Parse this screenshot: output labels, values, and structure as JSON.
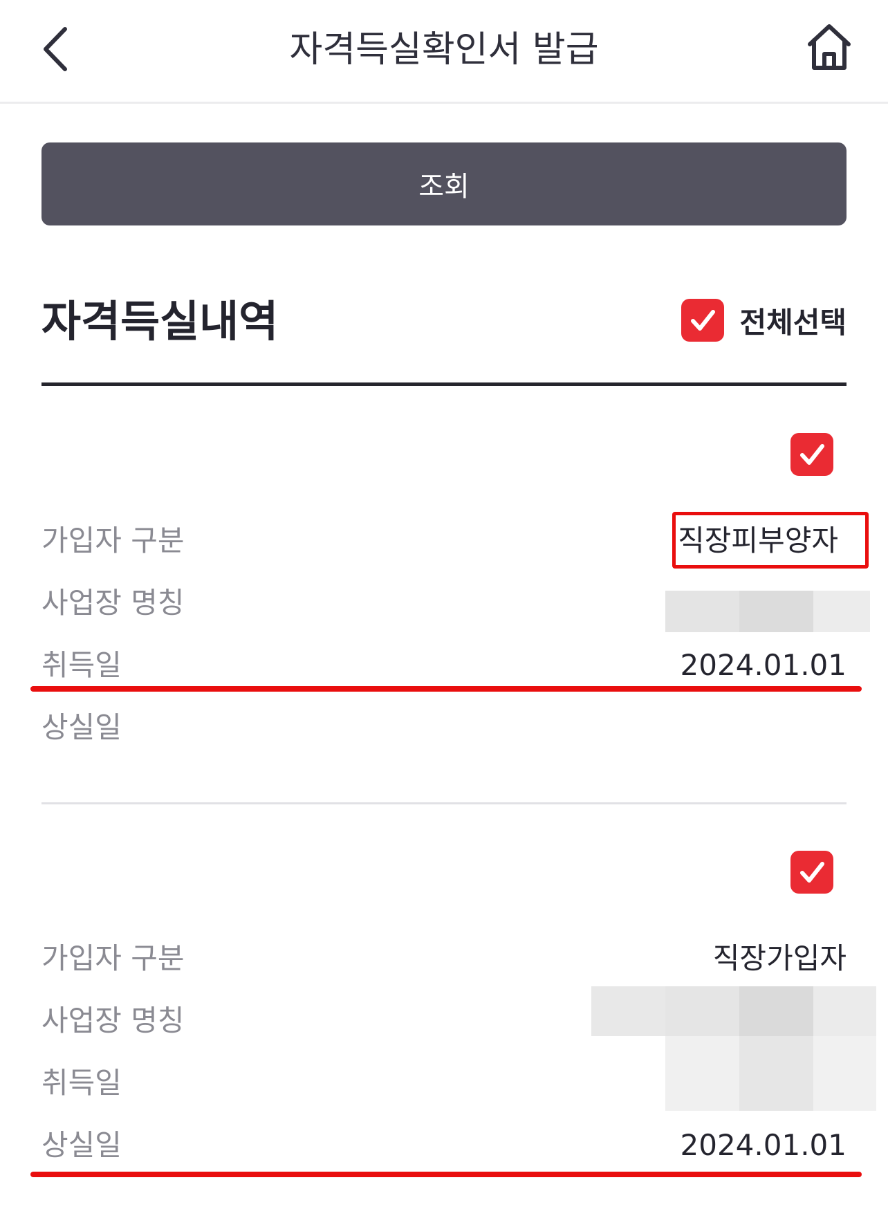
{
  "header": {
    "title": "자격득실확인서 발급",
    "back_icon": "chevron-left-icon",
    "home_icon": "home-icon"
  },
  "lookup_button": {
    "label": "조회"
  },
  "section": {
    "title": "자격득실내역",
    "select_all_label": "전체선택",
    "select_all_checked": true
  },
  "labels": {
    "subscriber_type": "가입자 구분",
    "workplace_name": "사업장 명칭",
    "acquisition_date": "취득일",
    "loss_date": "상실일"
  },
  "records": [
    {
      "checked": true,
      "subscriber_type": "직장피부양자",
      "workplace_name": "",
      "acquisition_date": "2024.01.01",
      "loss_date": ""
    },
    {
      "checked": true,
      "subscriber_type": "직장가입자",
      "workplace_name": "",
      "acquisition_date": "",
      "loss_date": "2024.01.01"
    }
  ],
  "colors": {
    "accent": "#ea2b33",
    "annotation_red": "#e90e0e",
    "button_bg": "#53525f"
  }
}
